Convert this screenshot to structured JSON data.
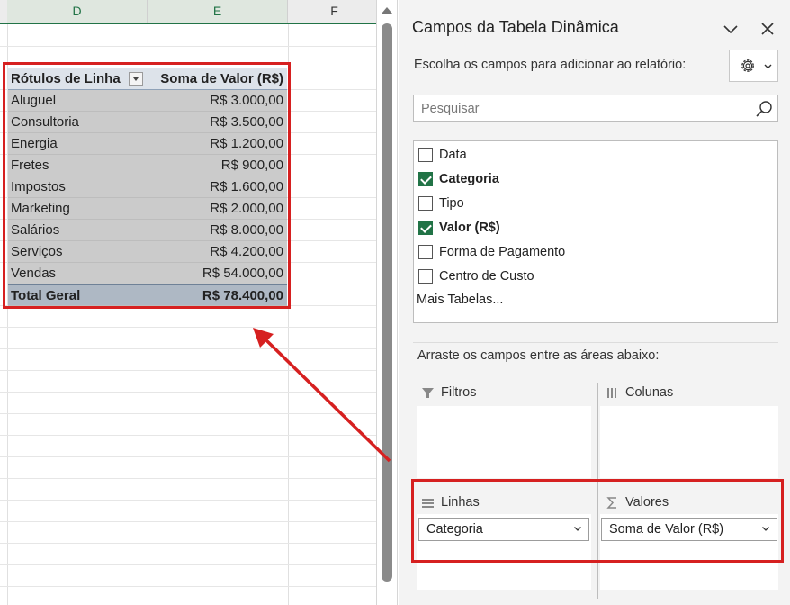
{
  "sheet": {
    "columns": [
      {
        "letter": "D",
        "selected": true
      },
      {
        "letter": "E",
        "selected": true
      },
      {
        "letter": "F",
        "selected": false
      }
    ]
  },
  "pivot": {
    "header": {
      "label": "Rótulos de Linha",
      "value": "Soma de Valor (R$)"
    },
    "rows": [
      {
        "label": "Aluguel",
        "value": "R$ 3.000,00"
      },
      {
        "label": "Consultoria",
        "value": "R$ 3.500,00"
      },
      {
        "label": "Energia",
        "value": "R$ 1.200,00"
      },
      {
        "label": "Fretes",
        "value": "R$ 900,00"
      },
      {
        "label": "Impostos",
        "value": "R$ 1.600,00"
      },
      {
        "label": "Marketing",
        "value": "R$ 2.000,00"
      },
      {
        "label": "Salários",
        "value": "R$ 8.000,00"
      },
      {
        "label": "Serviços",
        "value": "R$ 4.200,00"
      },
      {
        "label": "Vendas",
        "value": "R$ 54.000,00"
      }
    ],
    "total": {
      "label": "Total Geral",
      "value": "R$ 78.400,00"
    }
  },
  "pane": {
    "title": "Campos da Tabela Dinâmica",
    "subtitle": "Escolha os campos para adicionar ao relatório:",
    "search_placeholder": "Pesquisar",
    "fields": [
      {
        "label": "Data",
        "checked": false
      },
      {
        "label": "Categoria",
        "checked": true
      },
      {
        "label": "Tipo",
        "checked": false
      },
      {
        "label": "Valor (R$)",
        "checked": true
      },
      {
        "label": "Forma de Pagamento",
        "checked": false
      },
      {
        "label": "Centro de Custo",
        "checked": false
      }
    ],
    "more_tables": "Mais Tabelas...",
    "drag_text": "Arraste os campos entre as áreas abaixo:",
    "areas": {
      "filters": {
        "label": "Filtros",
        "icon": "filter-icon"
      },
      "columns": {
        "label": "Colunas",
        "icon": "columns-icon"
      },
      "rows": {
        "label": "Linhas",
        "icon": "rows-icon",
        "item": "Categoria"
      },
      "values": {
        "label": "Valores",
        "icon": "sigma-icon",
        "item": "Soma de Valor (R$)"
      }
    }
  },
  "colors": {
    "accent_green": "#217346",
    "highlight_red": "#d62020",
    "pivot_body": "#cbcbcb",
    "pivot_header": "#dde3ea",
    "pivot_total": "#aeb8c4"
  }
}
